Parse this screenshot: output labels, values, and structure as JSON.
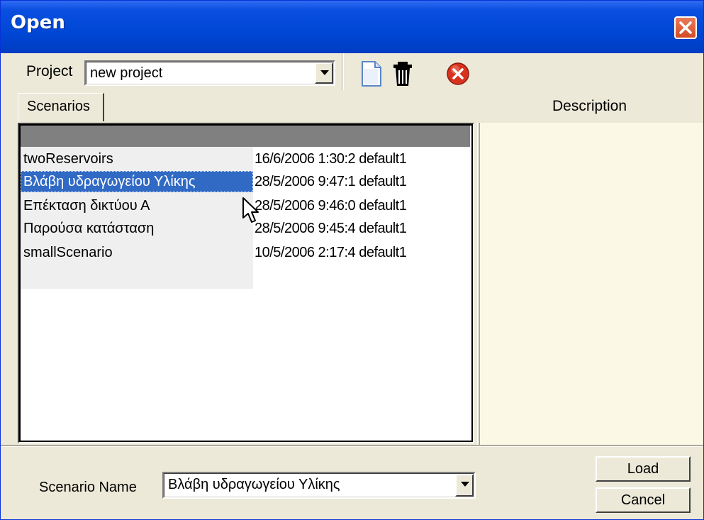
{
  "window": {
    "title": "Open"
  },
  "project": {
    "label": "Project",
    "selected": "new project"
  },
  "toolbar": {
    "new_icon": "new-document-icon",
    "delete_icon": "trash-icon",
    "remove_icon": "red-x-icon"
  },
  "tabs": {
    "scenarios": "Scenarios"
  },
  "description": {
    "header": "Description",
    "text": ""
  },
  "scenarios": [
    {
      "name": "twoReservoirs",
      "meta": "16/6/2006 1:30:2 default1"
    },
    {
      "name": "Βλάβη υδραγωγείου Υλίκης",
      "meta": "28/5/2006 9:47:1 default1",
      "selected": true
    },
    {
      "name": "Επέκταση δικτύου Α",
      "meta": "28/5/2006 9:46:0 default1"
    },
    {
      "name": "Παρούσα κατάσταση",
      "meta": "28/5/2006 9:45:4 default1"
    },
    {
      "name": "smallScenario",
      "meta": "10/5/2006 2:17:4 default1"
    }
  ],
  "scenario_name": {
    "label": "Scenario Name",
    "selected": "Βλάβη υδραγωγείου Υλίκης"
  },
  "buttons": {
    "load": "Load",
    "cancel": "Cancel"
  },
  "colors": {
    "titlebar": "#0047d6",
    "selection": "#316ac5",
    "face": "#ece9d8",
    "desc_bg": "#fbf8e6"
  }
}
